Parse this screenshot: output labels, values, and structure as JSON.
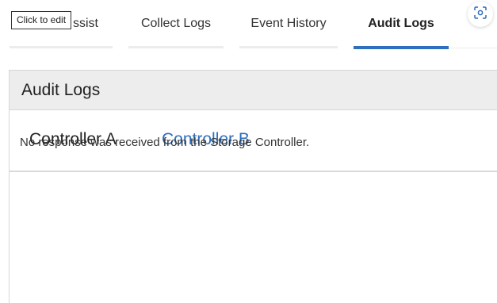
{
  "tabs": [
    {
      "label": "Support Assist",
      "visible_text": "ssist"
    },
    {
      "label": "Collect Logs"
    },
    {
      "label": "Event History"
    },
    {
      "label": "Audit Logs",
      "active": true
    }
  ],
  "tooltip": {
    "text": "Click to edit"
  },
  "corner_button": {
    "icon": "screen-capture-icon"
  },
  "panel": {
    "title": "Audit Logs",
    "controllers": [
      {
        "label": "Controller A",
        "selected": true
      },
      {
        "label": "Controller B",
        "selected": false
      }
    ],
    "message": "No response was received from the Storage Controller."
  },
  "colors": {
    "accent": "#2f6fbe",
    "header_bg": "#ededed",
    "border": "#d7d7d7"
  }
}
